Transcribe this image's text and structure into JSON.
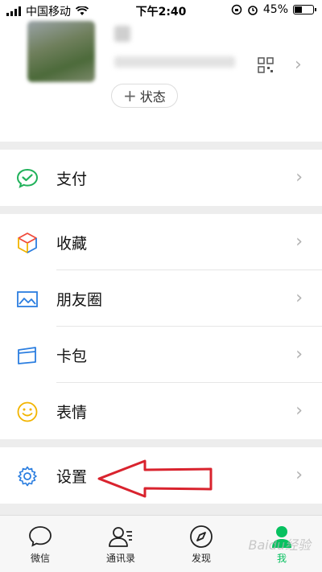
{
  "status_bar": {
    "carrier": "中国移动",
    "time": "下午2:40",
    "battery": "45%",
    "battery_level": 0.45
  },
  "profile": {
    "status_button": "状态",
    "plus": "+"
  },
  "menu": {
    "pay": "支付",
    "favorites": "收藏",
    "moments": "朋友圈",
    "cards": "卡包",
    "stickers": "表情",
    "settings": "设置"
  },
  "tabs": [
    {
      "label": "微信"
    },
    {
      "label": "通讯录"
    },
    {
      "label": "发现"
    },
    {
      "label": "我"
    }
  ],
  "watermark": "Baidu经验",
  "colors": {
    "accent": "#07c160",
    "arrow": "#d9232e"
  }
}
